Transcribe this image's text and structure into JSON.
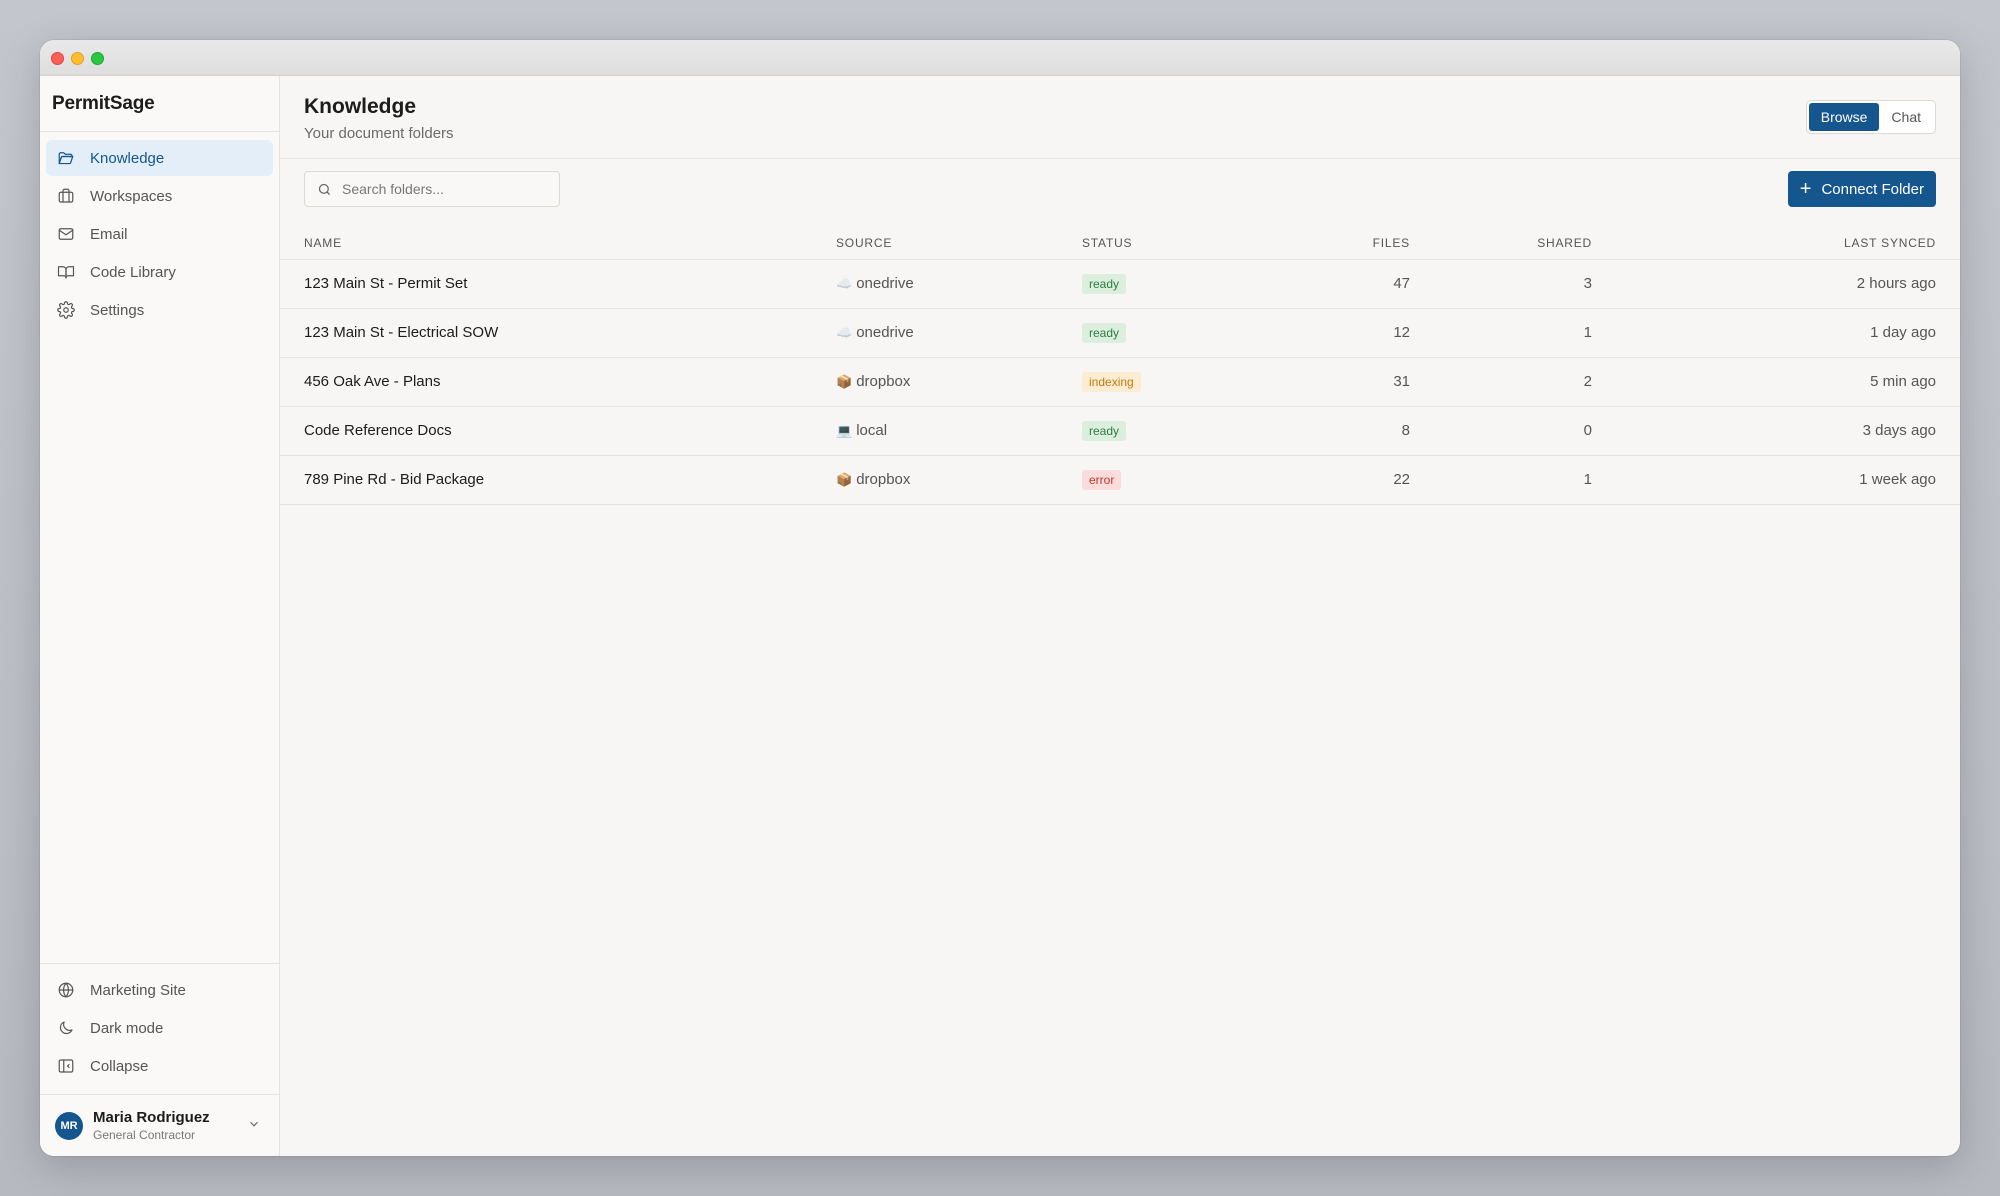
{
  "app": {
    "name": "PermitSage"
  },
  "sidebar": {
    "items": [
      {
        "label": "Knowledge",
        "icon": "folder-open-icon",
        "active": true
      },
      {
        "label": "Workspaces",
        "icon": "briefcase-icon",
        "active": false
      },
      {
        "label": "Email",
        "icon": "mail-icon",
        "active": false
      },
      {
        "label": "Code Library",
        "icon": "book-open-icon",
        "active": false
      },
      {
        "label": "Settings",
        "icon": "gear-icon",
        "active": false
      }
    ],
    "bottom": [
      {
        "label": "Marketing Site",
        "icon": "globe-icon"
      },
      {
        "label": "Dark mode",
        "icon": "moon-icon"
      },
      {
        "label": "Collapse",
        "icon": "panel-collapse-icon"
      }
    ],
    "user": {
      "initials": "MR",
      "name": "Maria Rodriguez",
      "role": "General Contractor"
    }
  },
  "header": {
    "title": "Knowledge",
    "subtitle": "Your document folders",
    "view_toggle": {
      "browse": "Browse",
      "chat": "Chat",
      "selected": "Browse"
    }
  },
  "toolbar": {
    "search_placeholder": "Search folders...",
    "connect_label": "Connect Folder"
  },
  "table": {
    "columns": [
      "Name",
      "Source",
      "Status",
      "Files",
      "Shared",
      "Last synced"
    ],
    "rows": [
      {
        "name": "123 Main St - Permit Set",
        "source_icon": "☁️",
        "source": "onedrive",
        "status": "ready",
        "files": "47",
        "shared": "3",
        "last_synced": "2 hours ago"
      },
      {
        "name": "123 Main St - Electrical SOW",
        "source_icon": "☁️",
        "source": "onedrive",
        "status": "ready",
        "files": "12",
        "shared": "1",
        "last_synced": "1 day ago"
      },
      {
        "name": "456 Oak Ave - Plans",
        "source_icon": "📦",
        "source": "dropbox",
        "status": "indexing",
        "files": "31",
        "shared": "2",
        "last_synced": "5 min ago"
      },
      {
        "name": "Code Reference Docs",
        "source_icon": "💻",
        "source": "local",
        "status": "ready",
        "files": "8",
        "shared": "0",
        "last_synced": "3 days ago"
      },
      {
        "name": "789 Pine Rd - Bid Package",
        "source_icon": "📦",
        "source": "dropbox",
        "status": "error",
        "files": "22",
        "shared": "1",
        "last_synced": "1 week ago"
      }
    ]
  },
  "colors": {
    "accent": "#15568f",
    "ready": "#2e7d3e",
    "indexing": "#c57a0a",
    "error": "#c0392b"
  }
}
